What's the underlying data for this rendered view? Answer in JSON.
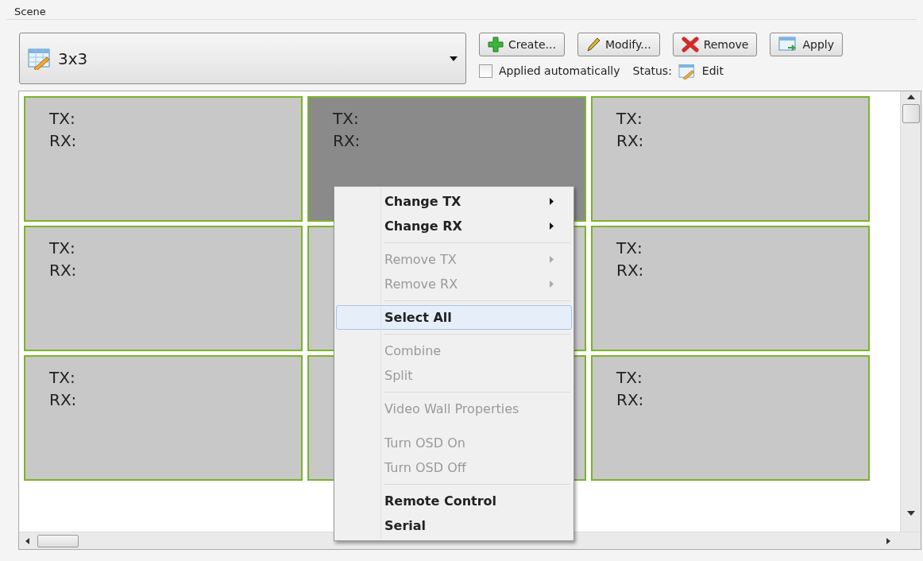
{
  "group_title": "Scene",
  "scene_select": {
    "value": "3x3"
  },
  "buttons": [
    {
      "label": "Create...",
      "kind": "create"
    },
    {
      "label": "Modify...",
      "kind": "modify"
    },
    {
      "label": "Remove",
      "kind": "remove"
    },
    {
      "label": "Apply",
      "kind": "apply"
    }
  ],
  "auto_apply": {
    "label": "Applied automatically",
    "checked": false
  },
  "status": {
    "label": "Status:",
    "value": "Edit"
  },
  "cells": [
    {
      "tx": "TX:",
      "rx": "RX:",
      "selected": false
    },
    {
      "tx": "TX:",
      "rx": "RX:",
      "selected": true
    },
    {
      "tx": "TX:",
      "rx": "RX:",
      "selected": false
    },
    {
      "tx": "TX:",
      "rx": "RX:",
      "selected": false
    },
    {
      "selected": false
    },
    {
      "tx": "TX:",
      "rx": "RX:",
      "selected": false
    },
    {
      "tx": "TX:",
      "rx": "RX:",
      "selected": false
    },
    {
      "selected": false
    },
    {
      "tx": "TX:",
      "rx": "RX:",
      "selected": false
    }
  ],
  "context_menu": [
    {
      "kind": "item",
      "label": "Change TX",
      "disabled": false,
      "submenu": true,
      "selected": false
    },
    {
      "kind": "item",
      "label": "Change RX",
      "disabled": false,
      "submenu": true,
      "selected": false
    },
    {
      "kind": "separator"
    },
    {
      "kind": "item",
      "label": "Remove TX",
      "disabled": true,
      "submenu": true,
      "selected": false
    },
    {
      "kind": "item",
      "label": "Remove RX",
      "disabled": true,
      "submenu": true,
      "selected": false
    },
    {
      "kind": "separator"
    },
    {
      "kind": "item",
      "label": "Select All",
      "disabled": false,
      "submenu": false,
      "selected": true
    },
    {
      "kind": "separator"
    },
    {
      "kind": "item",
      "label": "Combine",
      "disabled": true,
      "submenu": false,
      "selected": false
    },
    {
      "kind": "item",
      "label": "Split",
      "disabled": true,
      "submenu": false,
      "selected": false
    },
    {
      "kind": "separator"
    },
    {
      "kind": "item",
      "label": "Video Wall Properties",
      "disabled": true,
      "submenu": false,
      "selected": false
    },
    {
      "kind": "gap"
    },
    {
      "kind": "item",
      "label": "Turn OSD On",
      "disabled": true,
      "submenu": false,
      "selected": false
    },
    {
      "kind": "item",
      "label": "Turn OSD Off",
      "disabled": true,
      "submenu": false,
      "selected": false
    },
    {
      "kind": "separator"
    },
    {
      "kind": "item",
      "label": "Remote Control",
      "disabled": false,
      "submenu": false,
      "selected": false
    },
    {
      "kind": "item",
      "label": "Serial",
      "disabled": false,
      "submenu": false,
      "selected": false
    }
  ]
}
